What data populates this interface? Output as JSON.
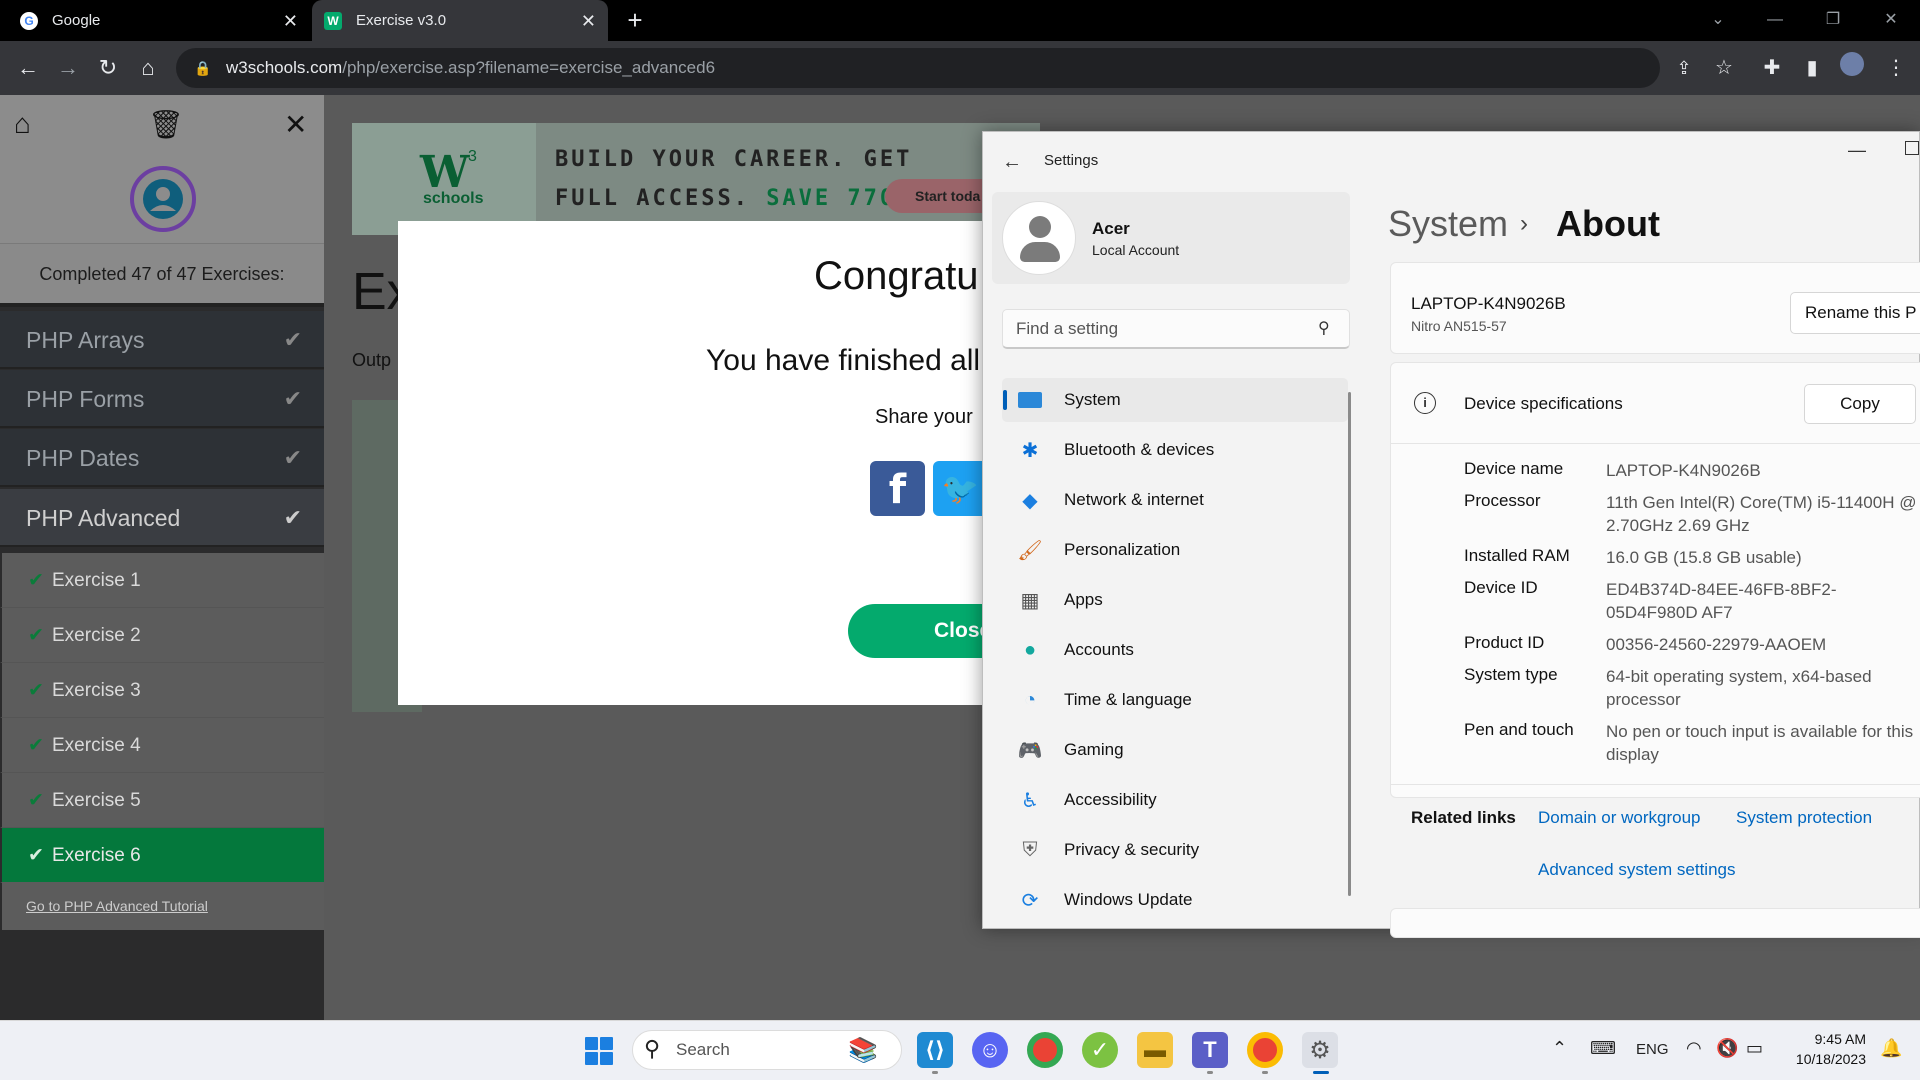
{
  "browser": {
    "tabs": [
      {
        "title": "Google",
        "icon": "google-icon"
      },
      {
        "title": "Exercise v3.0",
        "icon": "w3schools-icon"
      }
    ],
    "url_domain": "w3schools.com",
    "url_path": "/php/exercise.asp?filename=exercise_advanced6"
  },
  "w3": {
    "completed": "Completed 47 of 47 Exercises:",
    "categories": [
      "PHP Arrays",
      "PHP Forms",
      "PHP Dates",
      "PHP Advanced"
    ],
    "exercises": [
      "Exercise 1",
      "Exercise 2",
      "Exercise 3",
      "Exercise 4",
      "Exercise 5",
      "Exercise 6"
    ],
    "tutorial_link": "Go to PHP Advanced Tutorial",
    "banner": {
      "logo": "W",
      "logo_sup": "3",
      "logo_text": "schools",
      "line1": "BUILD YOUR CAREER. GET",
      "line2_a": "FULL ACCESS. ",
      "line2_b": "SAVE 770$",
      "button": "Start toda"
    },
    "page_title": "Ex",
    "output_label": "Outp",
    "modal": {
      "title": "Congratu",
      "message": "You have finished all",
      "share": "Share your",
      "close": "Close"
    }
  },
  "settings": {
    "window_title": "Settings",
    "user_name": "Acer",
    "user_type": "Local Account",
    "search_placeholder": "Find a setting",
    "nav": [
      {
        "label": "System",
        "icon": "system-icon"
      },
      {
        "label": "Bluetooth & devices",
        "icon": "bluetooth-icon"
      },
      {
        "label": "Network & internet",
        "icon": "wifi-icon"
      },
      {
        "label": "Personalization",
        "icon": "brush-icon"
      },
      {
        "label": "Apps",
        "icon": "apps-icon"
      },
      {
        "label": "Accounts",
        "icon": "account-icon"
      },
      {
        "label": "Time & language",
        "icon": "clock-globe-icon"
      },
      {
        "label": "Gaming",
        "icon": "gamepad-icon"
      },
      {
        "label": "Accessibility",
        "icon": "accessibility-icon"
      },
      {
        "label": "Privacy & security",
        "icon": "shield-icon"
      },
      {
        "label": "Windows Update",
        "icon": "update-icon"
      }
    ],
    "breadcrumb": {
      "parent": "System",
      "current": "About"
    },
    "device_name_header": "LAPTOP-K4N9026B",
    "device_model": "Nitro AN515-57",
    "rename_button": "Rename this P",
    "specs_heading": "Device specifications",
    "copy_button": "Copy",
    "specs": [
      {
        "label": "Device name",
        "value": "LAPTOP-K4N9026B"
      },
      {
        "label": "Processor",
        "value": "11th Gen Intel(R) Core(TM) i5-11400H @ 2.70GHz   2.69 GHz"
      },
      {
        "label": "Installed RAM",
        "value": "16.0 GB (15.8 GB usable)"
      },
      {
        "label": "Device ID",
        "value": "ED4B374D-84EE-46FB-8BF2-05D4F980D AF7"
      },
      {
        "label": "Product ID",
        "value": "00356-24560-22979-AAOEM"
      },
      {
        "label": "System type",
        "value": "64-bit operating system, x64-based processor"
      },
      {
        "label": "Pen and touch",
        "value": "No pen or touch input is available for this display"
      }
    ],
    "related_label": "Related links",
    "related_links": [
      "Domain or workgroup",
      "System protection",
      "Advanced system settings"
    ]
  },
  "taskbar": {
    "search_placeholder": "Search",
    "language": "ENG",
    "time": "9:45 AM",
    "date": "10/18/2023"
  }
}
